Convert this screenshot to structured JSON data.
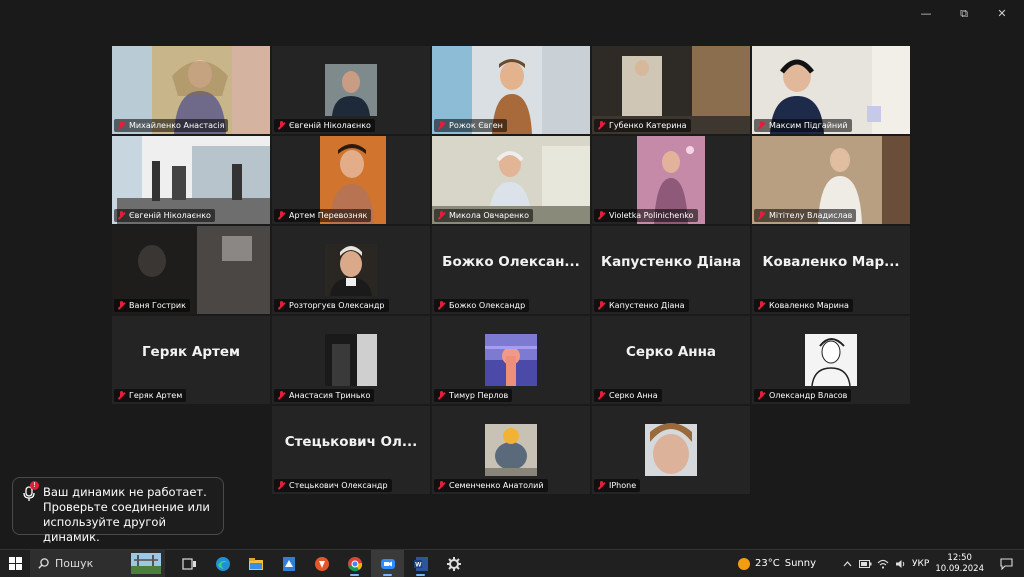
{
  "window": {
    "minimize": "—",
    "restore": "⧉",
    "close": "✕"
  },
  "participants": [
    {
      "name": "Михайленко Анастасія",
      "display": "",
      "kind": "video",
      "scene": "woman"
    },
    {
      "name": "Євгеній Ніколаєнко",
      "display": "",
      "kind": "avatar",
      "scene": "man-portrait"
    },
    {
      "name": "Рожок Євген",
      "display": "",
      "kind": "video",
      "scene": "boy-room"
    },
    {
      "name": "Губенко Катерина",
      "display": "",
      "kind": "video",
      "scene": "dark-room"
    },
    {
      "name": "Максим Підгайний",
      "display": "",
      "kind": "video",
      "scene": "headphones"
    },
    {
      "name": "Євгеній Ніколаєнко",
      "display": "",
      "kind": "video",
      "scene": "gym",
      "active": true
    },
    {
      "name": "Артем Перевозняк",
      "display": "",
      "kind": "video",
      "scene": "orange"
    },
    {
      "name": "Микола Овчаренко",
      "display": "",
      "kind": "video",
      "scene": "boy-headphones"
    },
    {
      "name": "Violetka Polinichenko",
      "display": "",
      "kind": "video",
      "scene": "pink"
    },
    {
      "name": "Мітітелу Владислав",
      "display": "",
      "kind": "video",
      "scene": "beige"
    },
    {
      "name": "Ваня Гострик",
      "display": "",
      "kind": "video",
      "scene": "dark"
    },
    {
      "name": "Розторгуєв Олександр",
      "display": "",
      "kind": "avatar",
      "scene": "portrait"
    },
    {
      "name": "Божко Олександр",
      "display": "Божко Олексан...",
      "kind": "name"
    },
    {
      "name": "Капустенко Діана",
      "display": "Капустенко Діана",
      "kind": "name"
    },
    {
      "name": "Коваленко Марина",
      "display": "Коваленко Мар...",
      "kind": "name"
    },
    {
      "name": "Геряк Артем",
      "display": "Геряк Артем",
      "kind": "name"
    },
    {
      "name": "Анастасия Тринько",
      "display": "",
      "kind": "avatar",
      "scene": "bw"
    },
    {
      "name": "Тимур Перлов",
      "display": "",
      "kind": "avatar",
      "scene": "sunset"
    },
    {
      "name": "Серко Анна",
      "display": "Серко Анна",
      "kind": "name"
    },
    {
      "name": "Олександр Власов",
      "display": "",
      "kind": "avatar",
      "scene": "sketch"
    },
    {
      "name": "Стецькович Олександр",
      "display": "Стецькович Ол...",
      "kind": "name"
    },
    {
      "name": "Семенченко Анатолий",
      "display": "",
      "kind": "avatar",
      "scene": "toy"
    },
    {
      "name": "IPhone",
      "display": "",
      "kind": "avatar",
      "scene": "face"
    }
  ],
  "toast": {
    "badge": "!",
    "message": "Ваш динамик не работает. Проверьте соединение или используйте другой динамик."
  },
  "taskbar": {
    "search_placeholder": "Пошук",
    "apps": [
      {
        "name": "task-view",
        "open": false
      },
      {
        "name": "edge",
        "open": false
      },
      {
        "name": "file-explorer",
        "open": false
      },
      {
        "name": "documents",
        "open": false
      },
      {
        "name": "app-orange",
        "open": false
      },
      {
        "name": "chrome",
        "open": true
      },
      {
        "name": "zoom",
        "open": true,
        "active": true
      },
      {
        "name": "word",
        "open": true
      },
      {
        "name": "settings",
        "open": false
      }
    ],
    "weather": {
      "temp": "23°C",
      "condition": "Sunny"
    },
    "lang": "УКР",
    "time": "12:50",
    "date": "10.09.2024"
  }
}
